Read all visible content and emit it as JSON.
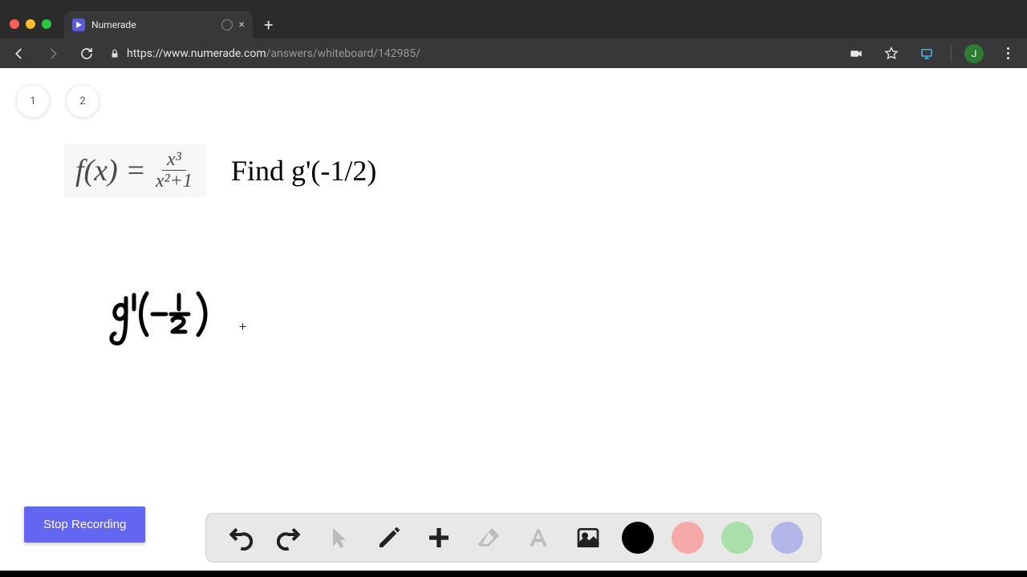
{
  "browser": {
    "tab_title": "Numerade",
    "url_domain": "https://www.numerade.com",
    "url_path": "/answers/whiteboard/142985/",
    "avatar_letter": "J"
  },
  "whiteboard": {
    "page_tabs": [
      "1",
      "2"
    ],
    "equation": {
      "lhs": "f(x) =",
      "numerator": "x³",
      "denominator": "x²+1"
    },
    "prompt": "Find g'(-1/2)",
    "handwritten": "g'(-½)",
    "cursor_symbol": "+"
  },
  "controls": {
    "stop_recording": "Stop Recording"
  },
  "toolbar": {
    "colors": {
      "black": "#000000",
      "red": "#f5a9a9",
      "green": "#a9dfa9",
      "blue": "#b3b6e8"
    }
  }
}
